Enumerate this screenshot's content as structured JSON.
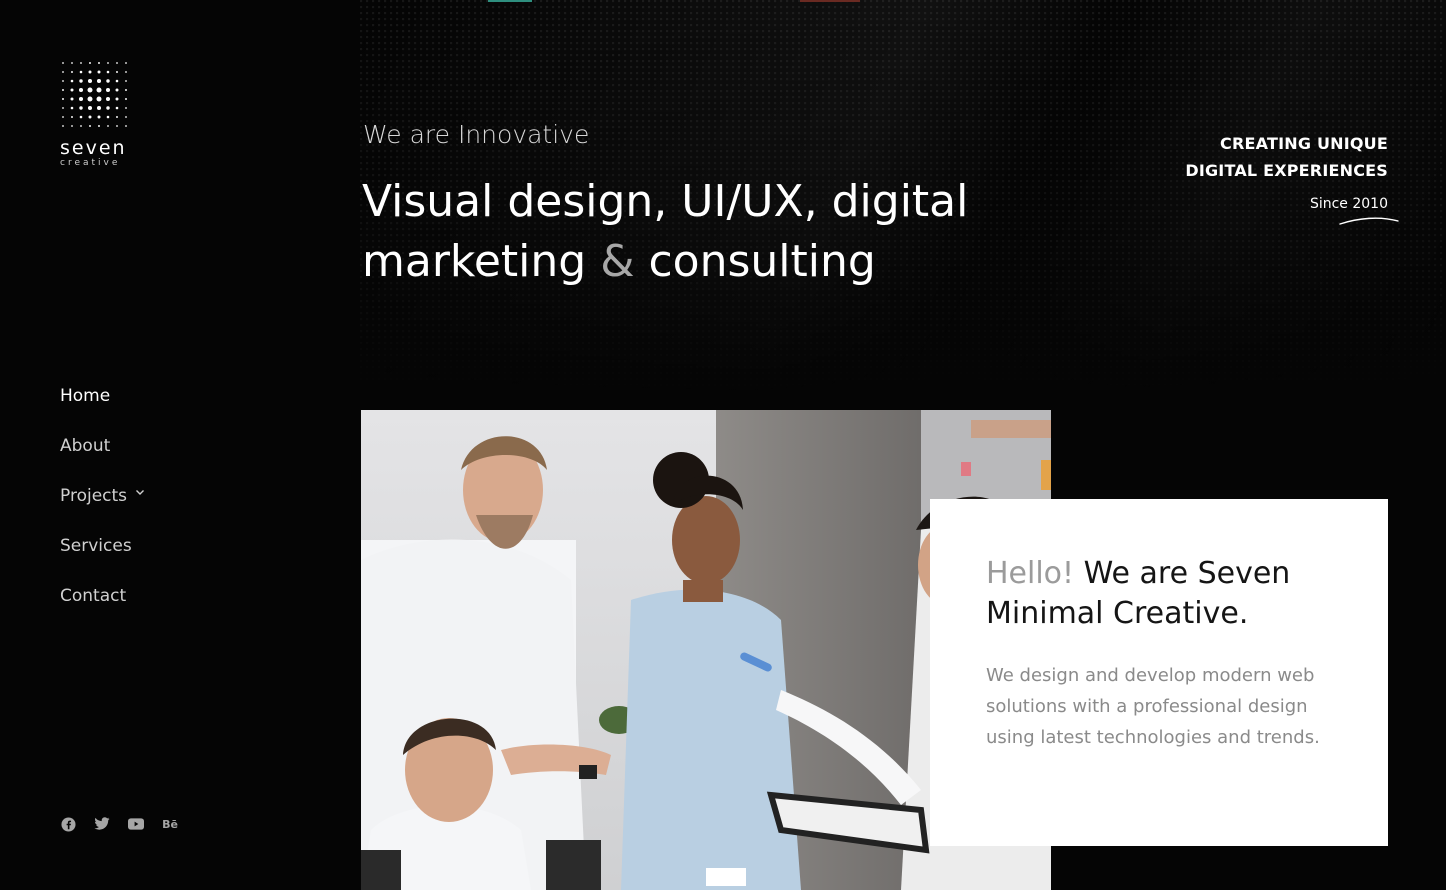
{
  "brand": {
    "name": "seven",
    "subtitle": "creative"
  },
  "nav": {
    "items": [
      {
        "label": "Home"
      },
      {
        "label": "About"
      },
      {
        "label": "Projects"
      },
      {
        "label": "Services"
      },
      {
        "label": "Contact"
      }
    ]
  },
  "socials": [
    {
      "icon": "facebook-icon"
    },
    {
      "icon": "twitter-icon"
    },
    {
      "icon": "youtube-icon"
    },
    {
      "icon": "behance-icon",
      "text": "Bē"
    }
  ],
  "hero": {
    "eyebrow": "We are Innovative",
    "headline_line1": "Visual design, UI/UX, digital",
    "headline_line2_a": "marketing ",
    "headline_amp": "&",
    "headline_line2_b": " consulting",
    "tagline_line1": "CREATING UNIQUE",
    "tagline_line2": "DIGITAL EXPERIENCES",
    "since": "Since 2010"
  },
  "card": {
    "hello": "Hello!",
    "title_rest": " We are Seven",
    "title_line2": "Minimal Creative.",
    "text": "We design and develop modern web solutions with a professional design using latest technologies and trends."
  },
  "colors": {
    "background": "#050505",
    "text": "#ffffff",
    "muted": "#a8a8a8",
    "card_bg": "#ffffff"
  }
}
